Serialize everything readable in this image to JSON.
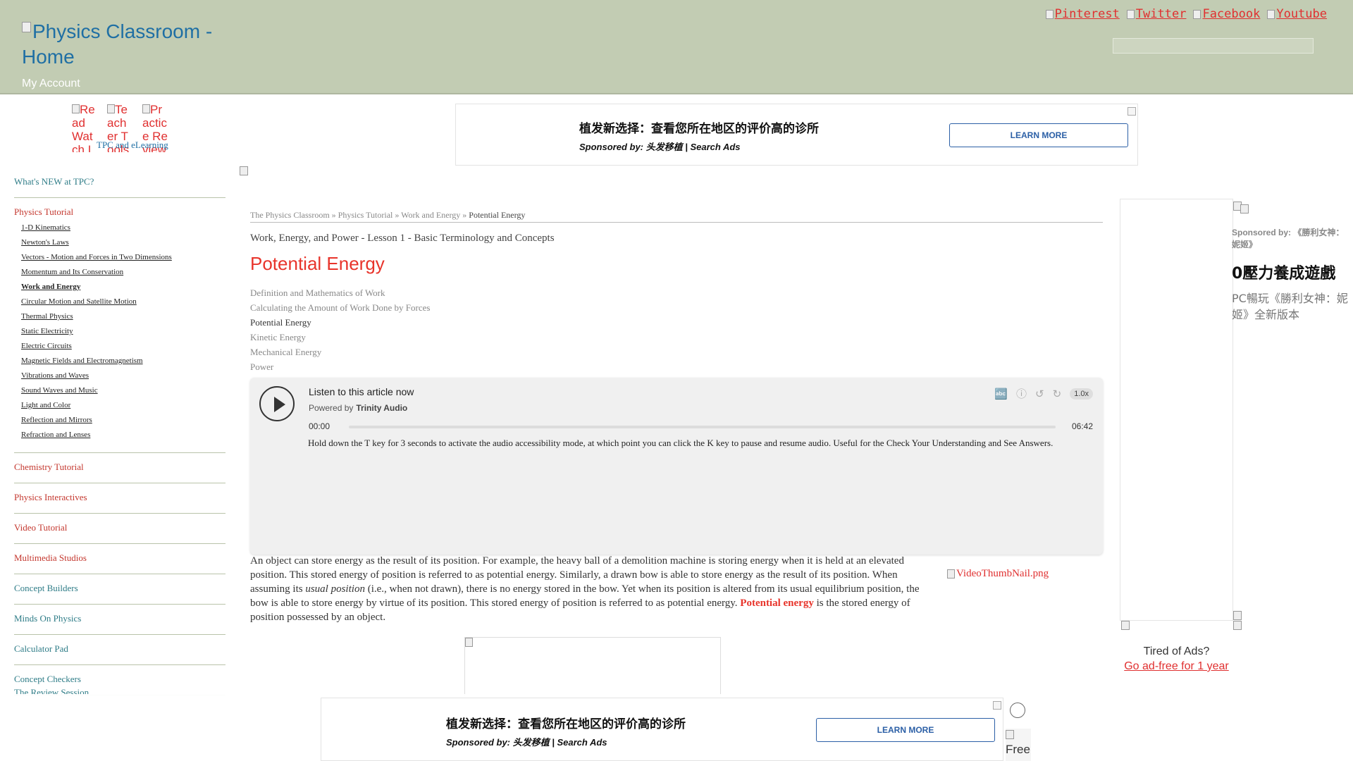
{
  "header": {
    "logo_alt": "Physics Classroom - Home",
    "my_account": "My Account",
    "social": [
      "Pinterest",
      "Twitter",
      "Facebook",
      "Youtube"
    ]
  },
  "sidebar": {
    "icons": [
      "Read Watch Interact",
      "Teacher Tools",
      "Practice Review Test"
    ],
    "tpc_elearning": "TPC and eLearning",
    "whats_new": "What's NEW at TPC?",
    "physics_tutorial": "Physics Tutorial",
    "tutorial_items": [
      "1-D Kinematics",
      "Newton's Laws",
      "Vectors - Motion and Forces in Two Dimensions",
      "Momentum and Its Conservation",
      "Work and Energy",
      "Circular Motion and Satellite Motion",
      "Thermal Physics",
      "Static Electricity",
      "Electric Circuits",
      "Magnetic Fields and Electromagnetism",
      "Vibrations and Waves",
      "Sound Waves and Music",
      "Light and Color",
      "Reflection and Mirrors",
      "Refraction and Lenses"
    ],
    "active_item": "Work and Energy",
    "sections": [
      "Chemistry Tutorial",
      "Physics Interactives",
      "Video Tutorial",
      "Multimedia Studios",
      "Concept Builders",
      "Minds On Physics",
      "Calculator Pad",
      "Concept Checkers"
    ],
    "review_session": "The Review Session"
  },
  "ads": {
    "top_title": "植发新选择：查看您所在地区的评价高的诊所",
    "top_sponsor": "Sponsored by: 头发移植 | Search Ads",
    "learn_more": "LEARN MORE",
    "bottom_title": "植发新选择：查看您所在地区的评价高的诊所",
    "bottom_sponsor": "Sponsored by: 头发移植 | Search Ads",
    "rail_sponsor": "Sponsored by: 《勝利女神：妮姬》",
    "rail_headline": "0壓力養成遊戲",
    "rail_body": "PC暢玩《勝利女神：妮姬》全新版本",
    "tired": "Tired of Ads?",
    "adfree": "Go ad-free for 1 year",
    "free_badge": "Free"
  },
  "breadcrumb": {
    "root": "The Physics Classroom",
    "tutorial": "Physics Tutorial",
    "unit": "Work and Energy",
    "current": "Potential Energy",
    "sep": "»"
  },
  "lesson": "Work, Energy, and Power - Lesson 1 - Basic Terminology and Concepts",
  "title": "Potential Energy",
  "toc": [
    "Definition and Mathematics of Work",
    "Calculating the Amount of Work Done by Forces",
    "Potential Energy",
    "Kinetic Energy",
    "Mechanical Energy",
    "Power"
  ],
  "player": {
    "listen": "Listen to this article now",
    "powered_by": "Powered by",
    "brand": "Trinity Audio",
    "speed": "1.0x",
    "time_start": "00:00",
    "time_end": "06:42",
    "progress": 0,
    "accessibility": "Hold down the T key for 3 seconds to activate the audio accessibility mode, at which point you can click the K key to pause and resume audio. Useful for the Check Your Understanding and See Answers."
  },
  "article": {
    "p1_a": "An object can store energy as the result of its position. For example, the heavy ball of a demolition machine is storing energy when it is held at an elevated position. This stored energy of position is referred to as potential energy. Similarly, a drawn bow is able to store energy as the result of its position. When assuming its ",
    "p1_em": "usual position",
    "p1_b": " (i.e., when not drawn), there is no energy stored in the bow. Yet when its position is altered from its usual equilibrium position, the bow is able to store energy by virtue of its position. This stored energy of position is referred to as potential energy. ",
    "p1_kw": "Potential energy",
    "p1_c": " is the stored energy of position possessed by an object.",
    "video_thumb": "VideoThumbNail.png"
  }
}
